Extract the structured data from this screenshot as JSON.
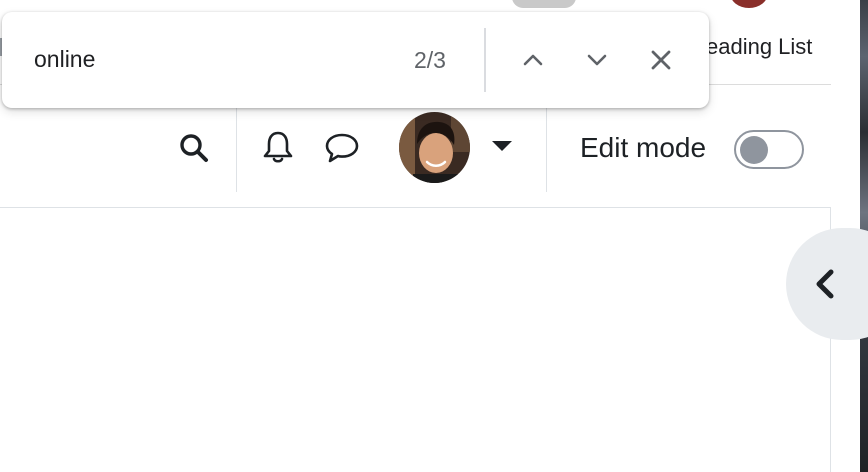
{
  "browser": {
    "reading_list_label": "eading List"
  },
  "find_bar": {
    "query": "online",
    "match_count": "2/3",
    "prev_icon": "chevron-up-icon",
    "next_icon": "chevron-down-icon",
    "close_icon": "close-icon"
  },
  "navbar": {
    "search_icon": "search-icon",
    "notifications_icon": "bell-icon",
    "messages_icon": "chat-bubble-icon",
    "user_menu_icon": "caret-down-icon",
    "edit_mode_label": "Edit mode",
    "edit_mode_on": false
  },
  "drawer": {
    "toggle_icon": "chevron-left-icon"
  },
  "colors": {
    "text": "#1d2125",
    "toggle_off": "#8f959e",
    "drawer_bg": "#e9ecef",
    "findbar_muted": "#5f6368"
  }
}
